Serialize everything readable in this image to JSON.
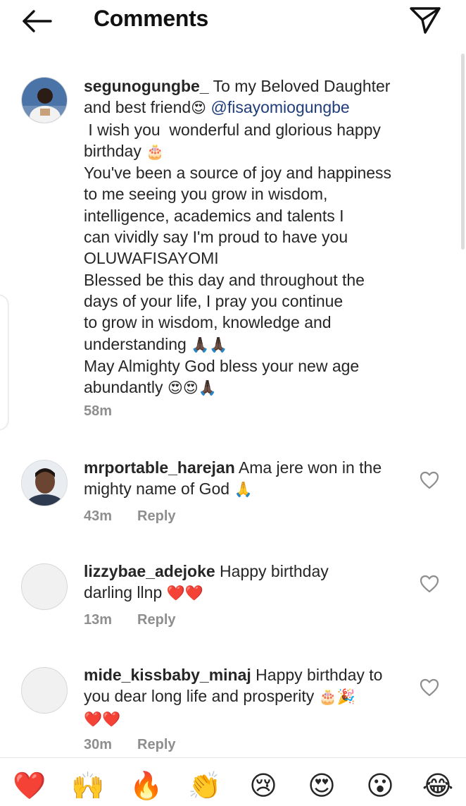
{
  "header": {
    "title": "Comments",
    "back_icon": "arrow-left-icon",
    "send_icon": "paper-plane-icon"
  },
  "comments": [
    {
      "username": "segunogungbe_",
      "lines": [
        " To my Beloved Daughter",
        "and best friend",
        " I wish you  wonderful and glorious happy",
        "birthday ",
        "You've been a source of joy and happiness",
        "to me seeing you grow in wisdom,",
        "intelligence, academics and talents I",
        "can vividly say I'm proud to have you",
        "OLUWAFISAYOMI",
        "Blessed be this day and throughout the",
        "days of your life, I pray you continue",
        "to grow in wisdom, knowledge and",
        "understanding ",
        "May Almighty God bless your new age",
        "abundantly "
      ],
      "mention": "@fisayomiogungbe",
      "emojis": {
        "friend": "😍",
        "birthday": "🎂",
        "understanding": "🙏🏿🙏🏿",
        "abundantly": "😍😍🙏🏿"
      },
      "time": "58m"
    },
    {
      "username": "mrportable_harejan",
      "lines": [
        " Ama jere won in the",
        "mighty name of God "
      ],
      "emojis": {
        "end": "🙏"
      },
      "time": "43m",
      "reply": "Reply"
    },
    {
      "username": "lizzybae_adejoke",
      "lines": [
        " Happy birthday",
        "darling llnp "
      ],
      "emojis": {
        "end": "❤️❤️"
      },
      "time": "13m",
      "reply": "Reply"
    },
    {
      "username": "mide_kissbaby_minaj",
      "lines": [
        " Happy birthday to",
        "you dear long life and prosperity ",
        ""
      ],
      "emojis": {
        "end1": "🎂🎉",
        "end2": "❤️❤️"
      },
      "time": "30m",
      "reply": "Reply"
    }
  ],
  "reactions": [
    "❤️",
    "🙌",
    "🔥",
    "👏",
    "😢",
    "😍",
    "😮",
    "😂"
  ],
  "colors": {
    "mention": "#1f3d7a",
    "meta": "#8e8e8e",
    "text": "#262626"
  }
}
